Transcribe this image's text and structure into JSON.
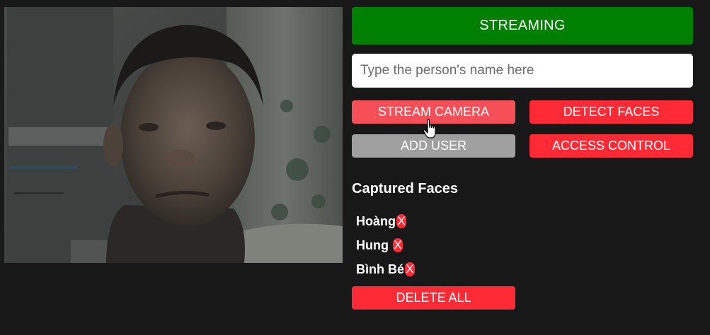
{
  "status": {
    "label": "STREAMING",
    "color": "#008000"
  },
  "name_input": {
    "placeholder": "Type the person's name here",
    "value": ""
  },
  "buttons": {
    "stream_camera": "STREAM CAMERA",
    "detect_faces": "DETECT FACES",
    "add_user": "ADD USER",
    "access_control": "ACCESS CONTROL",
    "delete_all": "DELETE ALL"
  },
  "captured_faces": {
    "title": "Captured Faces",
    "items": [
      {
        "name": "Hoàng",
        "remove": "X"
      },
      {
        "name": "Hung ",
        "remove": "X"
      },
      {
        "name": "Bình Bé",
        "remove": "X"
      }
    ]
  },
  "colors": {
    "background": "#181818",
    "accent_red": "#fe2b36",
    "disabled_gray": "#a0a0a0"
  },
  "icons": {
    "cursor": "hand-pointer-icon",
    "remove": "close-icon"
  }
}
